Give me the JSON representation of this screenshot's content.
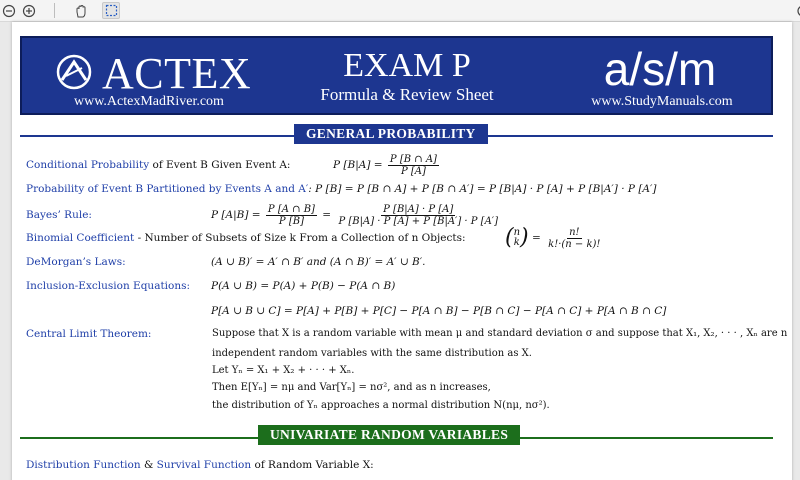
{
  "toolbar": {
    "zoom_out_icon": "zoom-out-icon",
    "zoom_in_icon": "zoom-in-icon",
    "hand_icon": "hand-tool-icon",
    "select_icon": "marquee-select-icon"
  },
  "banner": {
    "actex_name": "ACTEX",
    "actex_url": "www.ActexMadRiver.com",
    "exam_title": "EXAM P",
    "exam_subtitle": "Formula & Review Sheet",
    "asm_name": "a/s/m",
    "asm_url": "www.StudyManuals.com"
  },
  "colors": {
    "banner_blue": "#1d3690",
    "section_blue": "#1d3690",
    "section_green": "#1c6e1c",
    "link_blue": "#1f3fa8"
  },
  "sections": {
    "general": "GENERAL PROBABILITY",
    "univariate": "UNIVARIATE RANDOM VARIABLES"
  },
  "rows": {
    "cond_label": "Conditional Probability",
    "cond_rest": " of Event B Given Event A:",
    "cond_lhs": "P [B|A] =",
    "cond_num": "P [B ∩ A]",
    "cond_den": "P [A]",
    "part_label": "Probability of Event B Partitioned by Events A and A′",
    "part_formula": ": P [B] = P [B ∩ A] + P [B ∩ A′] = P [B|A] · P [A] + P [B|A′] · P [A′]",
    "bayes_label": "Bayes’ Rule:",
    "bayes_lhs": "P [A|B] =",
    "bayes_num1": "P [A ∩ B]",
    "bayes_den1": "P [B]",
    "bayes_eq": "=",
    "bayes_num2": "P [B|A] · P [A]",
    "bayes_den2": "P [B|A] · P [A] + P [B|A′] · P [A′]",
    "binom_label": "Binomial Coefficient",
    "binom_rest": " - Number of Subsets of Size k From a Collection of n Objects:",
    "binom_n": "n",
    "binom_k": "k",
    "binom_eq": "=",
    "binom_num": "n!",
    "binom_den": "k!·(n − k)!",
    "demorgan_label": "DeMorgan’s Laws:",
    "demorgan_formula": "(A ∪ B)′ = A′ ∩ B′ and (A ∩ B)′ = A′ ∪ B′.",
    "incl_label": "Inclusion-Exclusion Equations:",
    "incl_formula1": "P(A ∪ B) = P(A) + P(B) − P(A ∩ B)",
    "incl_formula2": "P[A ∪ B ∪ C] = P[A] + P[B] + P[C] − P[A ∩ B] − P[B ∩ C] − P[A ∩ C] + P[A ∩ B ∩ C]",
    "clt_label": "Central Limit Theorem:",
    "clt_line1": "Suppose that X is a random variable with mean μ and standard deviation σ and suppose that X₁, X₂, · · · , Xₙ are n",
    "clt_line2": "independent random variables with the same distribution as X.",
    "clt_line3": "Let Yₙ = X₁ + X₂ + · · · + Xₙ.",
    "clt_line4": "Then E[Yₙ] = nμ and Var[Yₙ] = nσ², and as n increases,",
    "clt_line5": "the distribution of Yₙ approaches a normal distribution N(nμ, nσ²).",
    "dist_label1": "Distribution Function",
    "dist_amp": " & ",
    "dist_label2": "Survival Function",
    "dist_rest": " of Random Variable X:"
  }
}
